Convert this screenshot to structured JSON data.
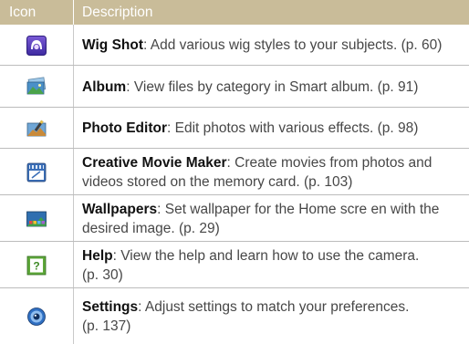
{
  "header": {
    "icon_col": "Icon",
    "desc_col": "Description"
  },
  "rows": [
    {
      "icon": "wig-shot-icon",
      "name": "Wig Shot",
      "desc_line1": ": Add various wig styles to your subjects. (p. 60)",
      "desc_line2": ""
    },
    {
      "icon": "album-icon",
      "name": "Album",
      "desc_line1": ": View files by category in Smart album. (p. 91)",
      "desc_line2": ""
    },
    {
      "icon": "photo-editor-icon",
      "name": "Photo Editor",
      "desc_line1": ": Edit photos with various effects. (p. 98)",
      "desc_line2": ""
    },
    {
      "icon": "creative-movie-maker-icon",
      "name": "Creative Movie Maker",
      "desc_line1": ": Create movies from photos and",
      "desc_line2": "videos stored on the memory card. (p. 103)"
    },
    {
      "icon": "wallpapers-icon",
      "name": "Wallpapers",
      "desc_line1": ": Set wallpaper for the Home scre en with the",
      "desc_line2": "desired image. (p. 29)"
    },
    {
      "icon": "help-icon",
      "name": "Help",
      "desc_line1": ": View the help and learn how to use the camera.",
      "desc_line2": "(p. 30)"
    },
    {
      "icon": "settings-icon",
      "name": "Settings",
      "desc_line1": ": Adjust settings to match your preferences.",
      "desc_line2": "(p. 137)"
    }
  ]
}
